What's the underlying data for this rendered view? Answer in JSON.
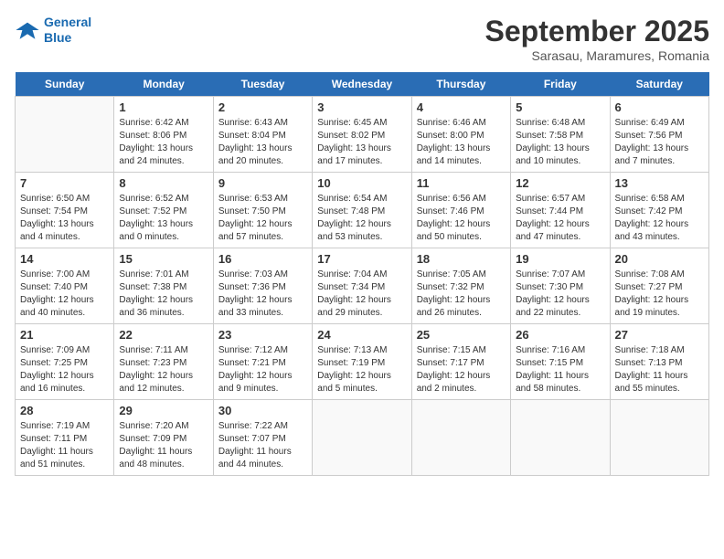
{
  "header": {
    "logo_line1": "General",
    "logo_line2": "Blue",
    "month_title": "September 2025",
    "subtitle": "Sarasau, Maramures, Romania"
  },
  "days_of_week": [
    "Sunday",
    "Monday",
    "Tuesday",
    "Wednesday",
    "Thursday",
    "Friday",
    "Saturday"
  ],
  "weeks": [
    [
      {
        "date": "",
        "info": ""
      },
      {
        "date": "1",
        "info": "Sunrise: 6:42 AM\nSunset: 8:06 PM\nDaylight: 13 hours\nand 24 minutes."
      },
      {
        "date": "2",
        "info": "Sunrise: 6:43 AM\nSunset: 8:04 PM\nDaylight: 13 hours\nand 20 minutes."
      },
      {
        "date": "3",
        "info": "Sunrise: 6:45 AM\nSunset: 8:02 PM\nDaylight: 13 hours\nand 17 minutes."
      },
      {
        "date": "4",
        "info": "Sunrise: 6:46 AM\nSunset: 8:00 PM\nDaylight: 13 hours\nand 14 minutes."
      },
      {
        "date": "5",
        "info": "Sunrise: 6:48 AM\nSunset: 7:58 PM\nDaylight: 13 hours\nand 10 minutes."
      },
      {
        "date": "6",
        "info": "Sunrise: 6:49 AM\nSunset: 7:56 PM\nDaylight: 13 hours\nand 7 minutes."
      }
    ],
    [
      {
        "date": "7",
        "info": "Sunrise: 6:50 AM\nSunset: 7:54 PM\nDaylight: 13 hours\nand 4 minutes."
      },
      {
        "date": "8",
        "info": "Sunrise: 6:52 AM\nSunset: 7:52 PM\nDaylight: 13 hours\nand 0 minutes."
      },
      {
        "date": "9",
        "info": "Sunrise: 6:53 AM\nSunset: 7:50 PM\nDaylight: 12 hours\nand 57 minutes."
      },
      {
        "date": "10",
        "info": "Sunrise: 6:54 AM\nSunset: 7:48 PM\nDaylight: 12 hours\nand 53 minutes."
      },
      {
        "date": "11",
        "info": "Sunrise: 6:56 AM\nSunset: 7:46 PM\nDaylight: 12 hours\nand 50 minutes."
      },
      {
        "date": "12",
        "info": "Sunrise: 6:57 AM\nSunset: 7:44 PM\nDaylight: 12 hours\nand 47 minutes."
      },
      {
        "date": "13",
        "info": "Sunrise: 6:58 AM\nSunset: 7:42 PM\nDaylight: 12 hours\nand 43 minutes."
      }
    ],
    [
      {
        "date": "14",
        "info": "Sunrise: 7:00 AM\nSunset: 7:40 PM\nDaylight: 12 hours\nand 40 minutes."
      },
      {
        "date": "15",
        "info": "Sunrise: 7:01 AM\nSunset: 7:38 PM\nDaylight: 12 hours\nand 36 minutes."
      },
      {
        "date": "16",
        "info": "Sunrise: 7:03 AM\nSunset: 7:36 PM\nDaylight: 12 hours\nand 33 minutes."
      },
      {
        "date": "17",
        "info": "Sunrise: 7:04 AM\nSunset: 7:34 PM\nDaylight: 12 hours\nand 29 minutes."
      },
      {
        "date": "18",
        "info": "Sunrise: 7:05 AM\nSunset: 7:32 PM\nDaylight: 12 hours\nand 26 minutes."
      },
      {
        "date": "19",
        "info": "Sunrise: 7:07 AM\nSunset: 7:30 PM\nDaylight: 12 hours\nand 22 minutes."
      },
      {
        "date": "20",
        "info": "Sunrise: 7:08 AM\nSunset: 7:27 PM\nDaylight: 12 hours\nand 19 minutes."
      }
    ],
    [
      {
        "date": "21",
        "info": "Sunrise: 7:09 AM\nSunset: 7:25 PM\nDaylight: 12 hours\nand 16 minutes."
      },
      {
        "date": "22",
        "info": "Sunrise: 7:11 AM\nSunset: 7:23 PM\nDaylight: 12 hours\nand 12 minutes."
      },
      {
        "date": "23",
        "info": "Sunrise: 7:12 AM\nSunset: 7:21 PM\nDaylight: 12 hours\nand 9 minutes."
      },
      {
        "date": "24",
        "info": "Sunrise: 7:13 AM\nSunset: 7:19 PM\nDaylight: 12 hours\nand 5 minutes."
      },
      {
        "date": "25",
        "info": "Sunrise: 7:15 AM\nSunset: 7:17 PM\nDaylight: 12 hours\nand 2 minutes."
      },
      {
        "date": "26",
        "info": "Sunrise: 7:16 AM\nSunset: 7:15 PM\nDaylight: 11 hours\nand 58 minutes."
      },
      {
        "date": "27",
        "info": "Sunrise: 7:18 AM\nSunset: 7:13 PM\nDaylight: 11 hours\nand 55 minutes."
      }
    ],
    [
      {
        "date": "28",
        "info": "Sunrise: 7:19 AM\nSunset: 7:11 PM\nDaylight: 11 hours\nand 51 minutes."
      },
      {
        "date": "29",
        "info": "Sunrise: 7:20 AM\nSunset: 7:09 PM\nDaylight: 11 hours\nand 48 minutes."
      },
      {
        "date": "30",
        "info": "Sunrise: 7:22 AM\nSunset: 7:07 PM\nDaylight: 11 hours\nand 44 minutes."
      },
      {
        "date": "",
        "info": ""
      },
      {
        "date": "",
        "info": ""
      },
      {
        "date": "",
        "info": ""
      },
      {
        "date": "",
        "info": ""
      }
    ]
  ]
}
